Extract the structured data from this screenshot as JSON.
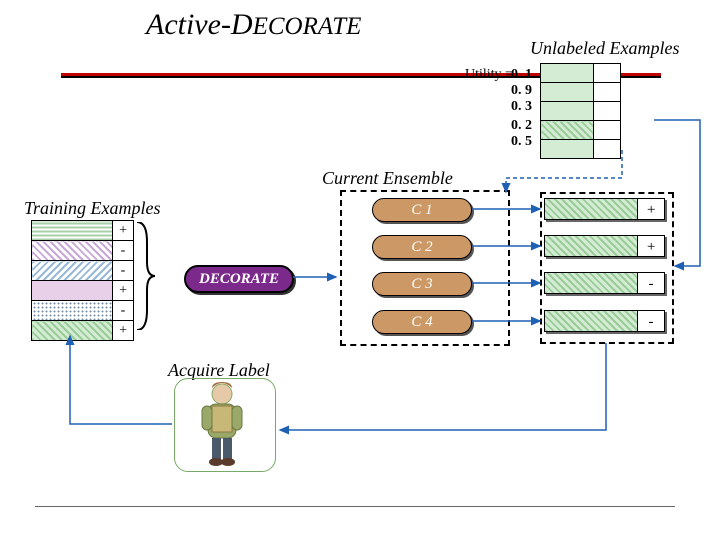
{
  "title_main": "Active-D",
  "title_sc": "ECORATE",
  "unlabeled_title": "Unlabeled Examples",
  "utility_label": "Utility =",
  "utilities": [
    "0. 1",
    "0. 9",
    "0. 3",
    "0. 2",
    "0. 5"
  ],
  "current_ensemble": "Current Ensemble",
  "training_title": "Training Examples",
  "train_signs": [
    "+",
    "-",
    "-",
    "+",
    "-",
    "+"
  ],
  "decorate": "DECORATE",
  "classifiers": [
    "C 1",
    "C 2",
    "C 3",
    "C 4"
  ],
  "example_signs": [
    "+",
    "+",
    "-",
    "-"
  ],
  "acquire": "Acquire Label"
}
